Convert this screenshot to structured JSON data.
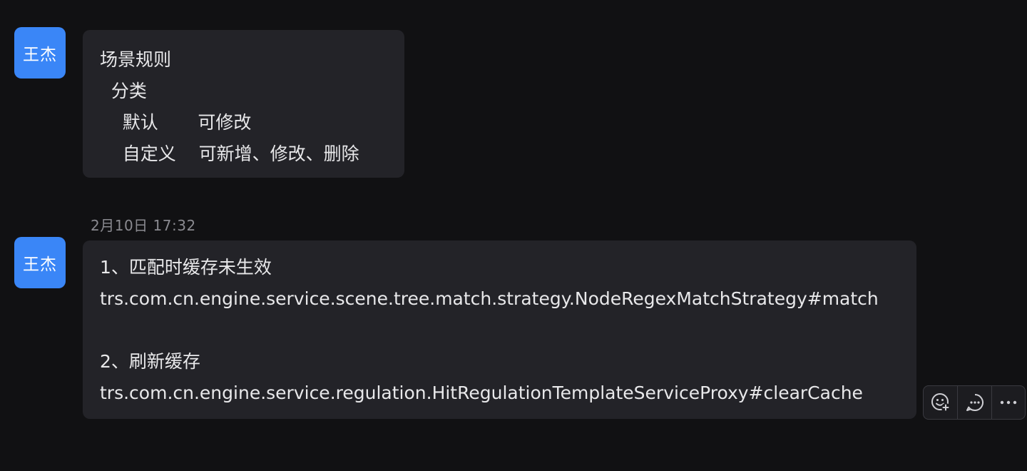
{
  "messages": [
    {
      "sender": "王杰",
      "lines": [
        "场景规则",
        "  分类",
        "    默认       可修改",
        "    自定义    可新增、修改、删除"
      ]
    },
    {
      "timestamp": "2月10日 17:32",
      "sender": "王杰",
      "lines": [
        "1、匹配时缓存未生效",
        "trs.com.cn.engine.service.scene.tree.match.strategy.NodeRegexMatchStrategy#match",
        "",
        "2、刷新缓存",
        "trs.com.cn.engine.service.regulation.HitRegulationTemplateServiceProxy#clearCache"
      ]
    }
  ],
  "actions": {
    "icons": [
      "add-reaction-icon",
      "reply-icon",
      "more-icon"
    ]
  },
  "colors": {
    "background": "#111113",
    "bubble": "#232328",
    "avatar": "#3a86f7",
    "timestamp": "#8a8a90"
  }
}
